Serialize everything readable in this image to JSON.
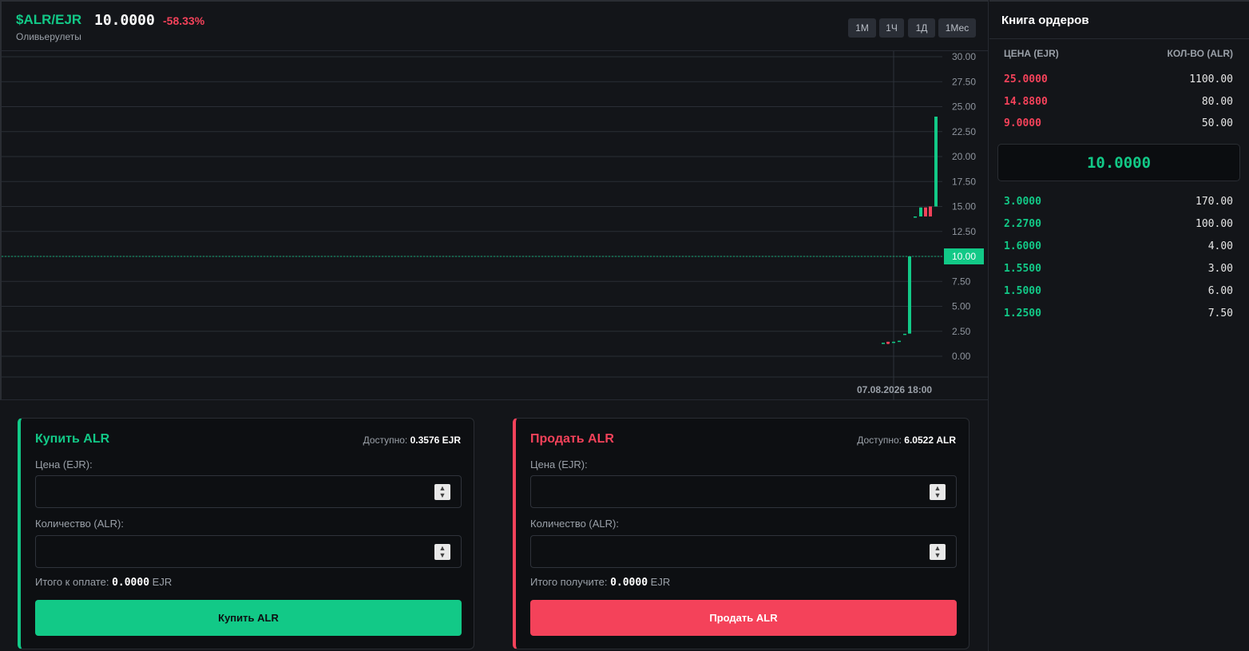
{
  "header": {
    "pair": "$ALR/EJR",
    "price": "10.0000",
    "change": "-58.33%",
    "subtitle": "Оливьерулеты",
    "timeframes": [
      "1М",
      "1Ч",
      "1Д",
      "1Мес"
    ]
  },
  "chart_data": {
    "type": "candlestick",
    "title": "",
    "xlabel": "",
    "ylabel": "",
    "ylim": [
      0,
      30
    ],
    "yticks": [
      "30.00",
      "27.50",
      "25.00",
      "22.50",
      "20.00",
      "17.50",
      "15.00",
      "12.50",
      "10.00",
      "7.50",
      "5.00",
      "2.50",
      "0.00"
    ],
    "ytick_values": [
      30,
      27.5,
      25,
      22.5,
      20,
      17.5,
      15,
      12.5,
      10,
      7.5,
      5,
      2.5,
      0
    ],
    "current_price": 10.0,
    "current_price_label": "10.00",
    "crosshair_label": "07.08.2026 18:00",
    "grid": true,
    "candles": [
      {
        "open": 1.35,
        "high": 1.35,
        "low": 1.35,
        "close": 1.35
      },
      {
        "open": 1.45,
        "high": 1.45,
        "low": 1.2,
        "close": 1.25
      },
      {
        "open": 1.35,
        "high": 1.45,
        "low": 1.35,
        "close": 1.45
      },
      {
        "open": 1.45,
        "high": 1.55,
        "low": 1.45,
        "close": 1.55
      },
      {
        "open": 2.25,
        "high": 2.25,
        "low": 2.25,
        "close": 2.25
      },
      {
        "open": 2.27,
        "high": 10.0,
        "low": 2.27,
        "close": 10.0
      },
      {
        "open": 14.0,
        "high": 14.0,
        "low": 14.0,
        "close": 14.0
      },
      {
        "open": 14.0,
        "high": 14.9,
        "low": 14.0,
        "close": 14.9
      },
      {
        "open": 14.9,
        "high": 14.9,
        "low": 14.0,
        "close": 14.0
      },
      {
        "open": 15.0,
        "high": 15.0,
        "low": 14.0,
        "close": 14.0
      },
      {
        "open": 15.0,
        "high": 24.0,
        "low": 15.0,
        "close": 24.0
      }
    ],
    "colors": {
      "up": "#12c987",
      "down": "#f4425a"
    }
  },
  "buy": {
    "title": "Купить ALR",
    "available_label": "Доступно:",
    "available_value": "0.3576 EJR",
    "price_label": "Цена (EJR):",
    "qty_label": "Количество (ALR):",
    "total_label": "Итого к оплате:",
    "total_value": "0.0000",
    "total_unit": "EJR",
    "button": "Купить ALR"
  },
  "sell": {
    "title": "Продать ALR",
    "available_label": "Доступно:",
    "available_value": "6.0522 ALR",
    "price_label": "Цена (EJR):",
    "qty_label": "Количество (ALR):",
    "total_label": "Итого получите:",
    "total_value": "0.0000",
    "total_unit": "EJR",
    "button": "Продать ALR"
  },
  "orderbook": {
    "title": "Книга ордеров",
    "price_header": "ЦЕНА (EJR)",
    "qty_header": "КОЛ-ВО (ALR)",
    "asks": [
      {
        "price": "25.0000",
        "qty": "1100.00"
      },
      {
        "price": "14.8800",
        "qty": "80.00"
      },
      {
        "price": "9.0000",
        "qty": "50.00"
      }
    ],
    "mid": "10.0000",
    "bids": [
      {
        "price": "3.0000",
        "qty": "170.00"
      },
      {
        "price": "2.2700",
        "qty": "100.00"
      },
      {
        "price": "1.6000",
        "qty": "4.00"
      },
      {
        "price": "1.5500",
        "qty": "3.00"
      },
      {
        "price": "1.5000",
        "qty": "6.00"
      },
      {
        "price": "1.2500",
        "qty": "7.50"
      }
    ]
  }
}
